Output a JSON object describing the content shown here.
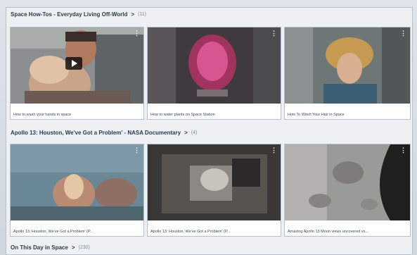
{
  "sections": [
    {
      "title": "Space How-Tos - Everyday Living Off-World",
      "chevron": ">",
      "count": "(11)",
      "videos": [
        {
          "caption": "How to wash your hands in space"
        },
        {
          "caption": "How to water plants on Space Station"
        },
        {
          "caption": "How To Wash Your Hair in Space"
        }
      ]
    },
    {
      "title": "Apollo 13: Houston, We've Got a Problem' - NASA Documentary",
      "chevron": ">",
      "count": "(4)",
      "videos": [
        {
          "caption": "Apollo 13: Houston, We've Got a Problem' (P..."
        },
        {
          "caption": "Apollo 13: Houston, We've Got a Problem' (P..."
        },
        {
          "caption": "Amazing Apollo 13 Moon views uncovered vs..."
        }
      ]
    },
    {
      "title": "On This Day in Space",
      "chevron": ">",
      "count": "(230)"
    }
  ],
  "icons": {
    "menu": "more-vertical-icon",
    "play": "play-icon"
  },
  "more_glyph": "⋮"
}
